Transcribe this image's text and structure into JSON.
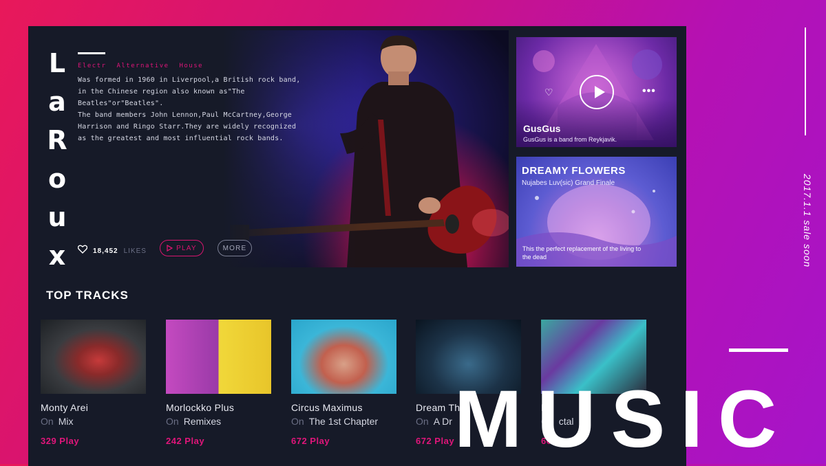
{
  "artist": {
    "letters": [
      "L",
      "a",
      "R",
      "o",
      "u",
      "x"
    ],
    "genres": [
      "Electr",
      "Alternative",
      "House"
    ],
    "description": [
      "Was formed in 1960 in Liverpool,a British rock band,",
      "in the Chinese region also known as\"The Beatles\"or\"Beatles\".",
      "The band members John Lennon,Paul McCartney,George",
      "Harrison and Ringo Starr.They are widely recognized",
      "as the greatest and most influential rock bands."
    ],
    "likes_count": "18,452",
    "likes_label": "LIKES",
    "play_label": "PLAY",
    "more_label": "MORE"
  },
  "featured": [
    {
      "title": "GusGus",
      "subtitle": "GusGus is a band from Reykjavik."
    },
    {
      "title": "DREAMY FLOWERS",
      "subtitle": "Nujabes Luv(sic) Grand Finale",
      "note": "This the perfect replacement of the living to the dead"
    }
  ],
  "top_tracks": {
    "heading": "TOP TRACKS",
    "on_label": "On",
    "items": [
      {
        "name": "Monty Arei",
        "album": "Mix",
        "plays": "329 Play"
      },
      {
        "name": "Morlockko Plus",
        "album": "Remixes",
        "plays": "242 Play"
      },
      {
        "name": "Circus Maximus",
        "album": "The 1st Chapter",
        "plays": "672 Play"
      },
      {
        "name": "Dream Th",
        "album": "A Dr",
        "plays": "672 Play"
      },
      {
        "name": "Dr",
        "album": "ctal",
        "plays": "66"
      }
    ]
  },
  "promo": {
    "sale_text": "2017.1.1 sale soon",
    "big_word": "MUSIC"
  },
  "colors": {
    "accent": "#e0157a",
    "panel": "#161a28"
  }
}
